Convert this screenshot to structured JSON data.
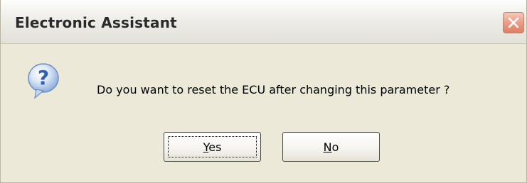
{
  "window": {
    "title": "Electronic Assistant",
    "close_icon": "close-icon"
  },
  "dialog": {
    "icon": "question-icon",
    "message": "Do you want to reset the ECU after changing this parameter ?"
  },
  "buttons": {
    "yes": {
      "mnemonic": "Y",
      "rest": "es"
    },
    "no": {
      "mnemonic": "N",
      "rest": "o"
    }
  },
  "colors": {
    "dialog_background": "#ece9d8",
    "close_button": "#e99a84",
    "question_icon": "#2f5fb3"
  }
}
